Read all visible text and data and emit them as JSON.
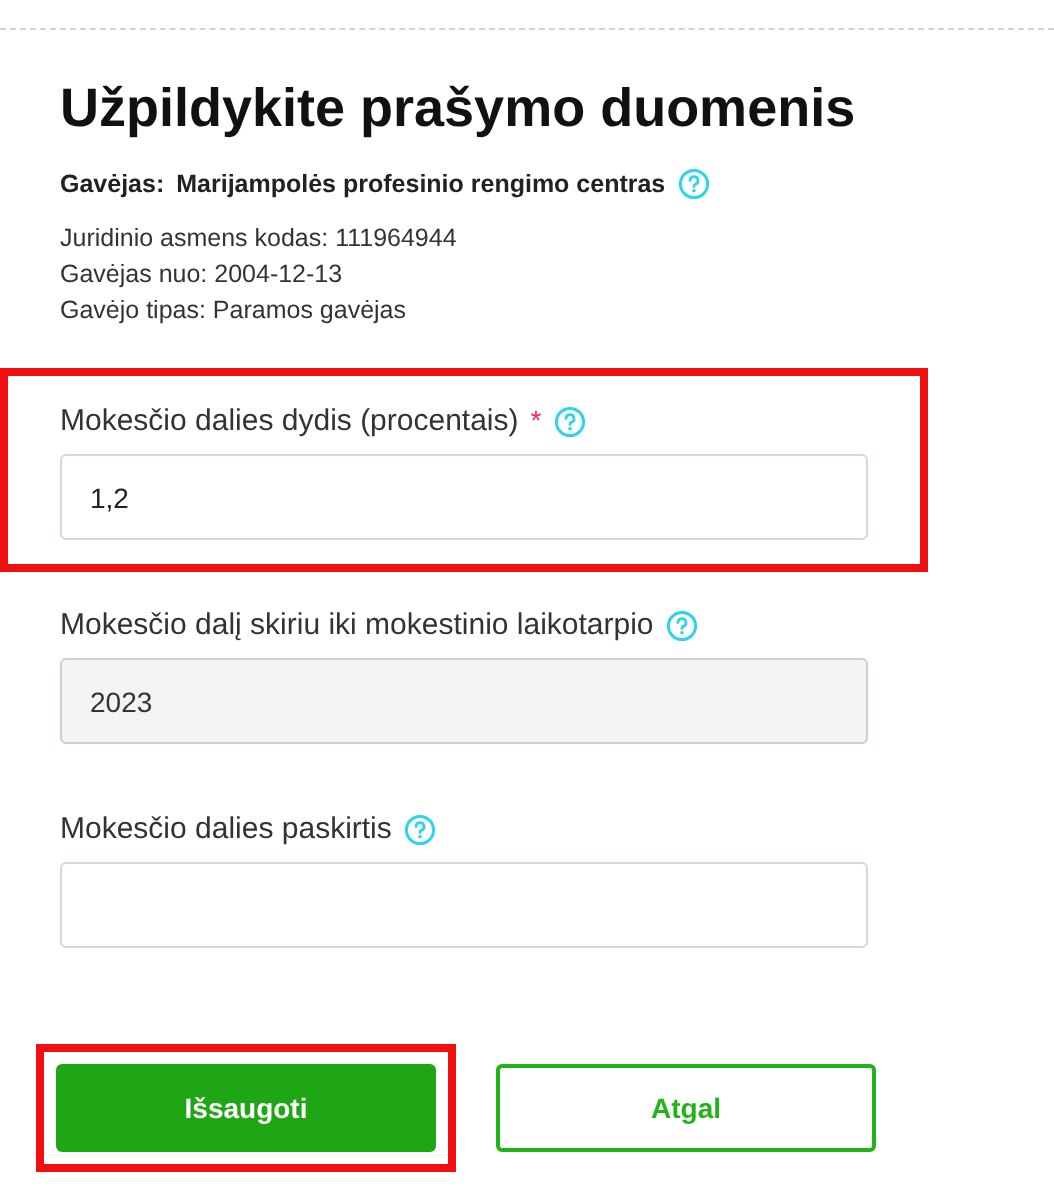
{
  "title": "Užpildykite prašymo duomenis",
  "recipient": {
    "label": "Gavėjas:",
    "name": "Marijampolės profesinio rengimo centras"
  },
  "details": [
    "Juridinio asmens kodas: 111964944",
    "Gavėjas nuo: 2004-12-13",
    "Gavėjo tipas: Paramos gavėjas"
  ],
  "fields": [
    {
      "label": "Mokesčio dalies dydis (procentais)",
      "required_mark": "*",
      "value": "1,2",
      "disabled": false,
      "highlighted": true
    },
    {
      "label": "Mokesčio dalį skiriu iki mokestinio laikotarpio",
      "value": "2023",
      "disabled": true,
      "highlighted": false
    },
    {
      "label": "Mokesčio dalies paskirtis",
      "disabled": false,
      "highlighted": false
    }
  ],
  "buttons": [
    {
      "label": "Išsaugoti",
      "kind": "primary",
      "highlighted": true
    },
    {
      "label": "Atgal",
      "kind": "secondary",
      "highlighted": false
    }
  ]
}
